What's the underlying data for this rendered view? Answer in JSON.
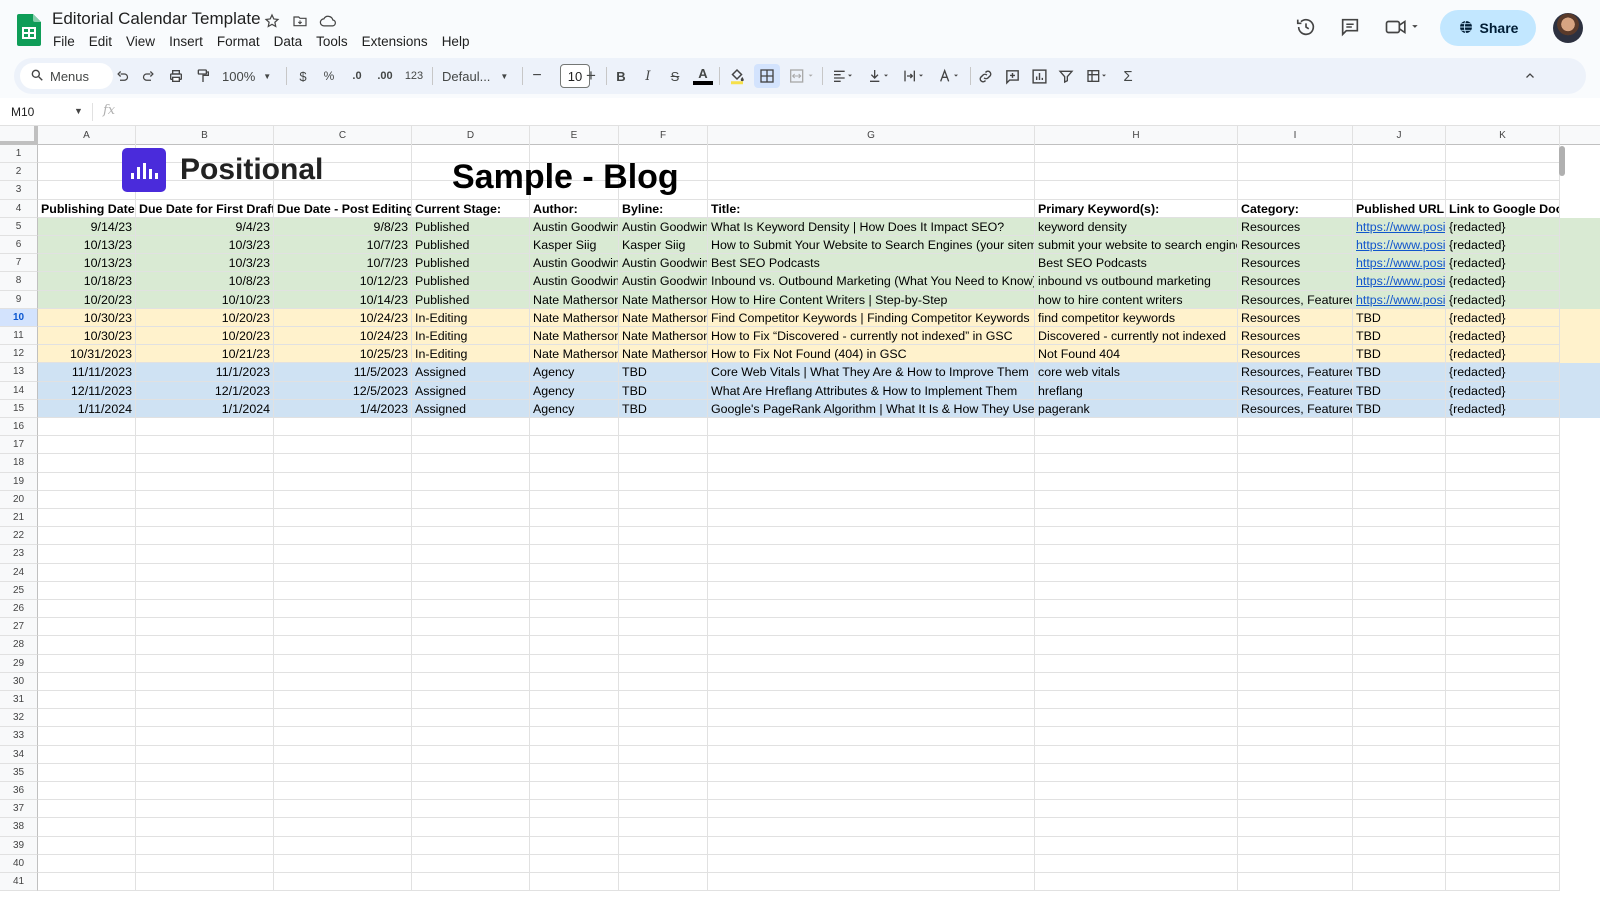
{
  "app": {
    "doc_title": "Editorial Calendar Template",
    "menus": [
      "File",
      "Edit",
      "View",
      "Insert",
      "Format",
      "Data",
      "Tools",
      "Extensions",
      "Help"
    ],
    "share_label": "Share"
  },
  "toolbar": {
    "menus_search": "Menus",
    "zoom": "100%",
    "currency": "$",
    "percent": "%",
    "dec_decrease": ".0",
    "dec_increase": ".00",
    "number_format": "123",
    "font": "Defaul...",
    "font_size": "10",
    "minus": "−",
    "plus": "+",
    "bold": "B",
    "italic": "I",
    "strike": "S",
    "text_color": "A",
    "sigma": "Σ"
  },
  "formula_bar": {
    "name_box": "M10",
    "fx": "fx"
  },
  "columns": [
    "A",
    "B",
    "C",
    "D",
    "E",
    "F",
    "G",
    "H",
    "I",
    "J",
    "K"
  ],
  "brand": {
    "name": "Positional"
  },
  "sheet_title": "Sample - Blog",
  "headers": [
    "Publishing Date:",
    "Due Date for First Draft:",
    "Due Date - Post Editing:",
    "Current Stage:",
    "Author:",
    "Byline:",
    "Title:",
    "Primary Keyword(s):",
    "Category:",
    "Published URL:",
    "Link to Google Doc"
  ],
  "rows": [
    {
      "status": "published",
      "cells": [
        "9/14/23",
        "9/4/23",
        "9/8/23",
        "Published",
        "Austin Goodwin",
        "Austin Goodwin",
        "What Is Keyword Density | How Does It Impact SEO?",
        "keyword density",
        "Resources",
        "https://www.positi",
        "{redacted}"
      ]
    },
    {
      "status": "published",
      "cells": [
        "10/13/23",
        "10/3/23",
        "10/7/23",
        "Published",
        "Kasper Siig",
        "Kasper Siig",
        "How to Submit Your Website to Search Engines (your sitemap)",
        "submit your website to search engines",
        "Resources",
        "https://www.positi",
        "{redacted}"
      ]
    },
    {
      "status": "published",
      "cells": [
        "10/13/23",
        "10/3/23",
        "10/7/23",
        "Published",
        "Austin Goodwin",
        "Austin Goodwin",
        "Best SEO Podcasts",
        "Best SEO Podcasts",
        "Resources",
        "https://www.positi",
        "{redacted}"
      ]
    },
    {
      "status": "published",
      "cells": [
        "10/18/23",
        "10/8/23",
        "10/12/23",
        "Published",
        "Austin Goodwin",
        "Austin Goodwin",
        "Inbound vs. Outbound Marketing (What You Need to Know)",
        "inbound vs outbound marketing",
        "Resources",
        "https://www.positi",
        "{redacted}"
      ]
    },
    {
      "status": "published",
      "cells": [
        "10/20/23",
        "10/10/23",
        "10/14/23",
        "Published",
        "Nate Matherson",
        "Nate Matherson",
        "How to Hire Content Writers | Step-by-Step",
        "how to hire content writers",
        "Resources, Featured",
        "https://www.positi",
        "{redacted}"
      ]
    },
    {
      "status": "editing",
      "cells": [
        "10/30/23",
        "10/20/23",
        "10/24/23",
        "In-Editing",
        "Nate Matherson",
        "Nate Matherson",
        "Find Competitor Keywords | Finding Competitor Keywords",
        "find competitor keywords",
        "Resources",
        "TBD",
        "{redacted}"
      ]
    },
    {
      "status": "editing",
      "cells": [
        "10/30/23",
        "10/20/23",
        "10/24/23",
        "In-Editing",
        "Nate Matherson",
        "Nate Matherson",
        "How to Fix “Discovered - currently not indexed” in GSC",
        "Discovered - currently not indexed",
        "Resources",
        "TBD",
        "{redacted}"
      ]
    },
    {
      "status": "editing",
      "cells": [
        "10/31/2023",
        "10/21/23",
        "10/25/23",
        "In-Editing",
        "Nate Matherson",
        "Nate Matherson",
        "How to Fix Not Found (404) in GSC",
        "Not Found 404",
        "Resources",
        "TBD",
        "{redacted}"
      ]
    },
    {
      "status": "assigned",
      "cells": [
        "11/11/2023",
        "11/1/2023",
        "11/5/2023",
        "Assigned",
        "Agency",
        "TBD",
        "Core Web Vitals | What They Are & How to Improve Them",
        "core web vitals",
        "Resources, Featured",
        "TBD",
        "{redacted}"
      ]
    },
    {
      "status": "assigned",
      "cells": [
        "12/11/2023",
        "12/1/2023",
        "12/5/2023",
        "Assigned",
        "Agency",
        "TBD",
        "What Are Hreflang Attributes & How to Implement Them",
        "hreflang",
        "Resources, Featured",
        "TBD",
        "{redacted}"
      ]
    },
    {
      "status": "assigned",
      "cells": [
        "1/11/2024",
        "1/1/2024",
        "1/4/2023",
        "Assigned",
        "Agency",
        "TBD",
        "Google's PageRank Algorithm | What It Is & How They Use It",
        "pagerank",
        "Resources, Featured",
        "TBD",
        "{redacted}"
      ]
    }
  ],
  "row_numbers": [
    "1",
    "2",
    "3",
    "4",
    "5",
    "6",
    "7",
    "8",
    "9",
    "10",
    "11",
    "12",
    "13",
    "14",
    "15",
    "16",
    "17",
    "18",
    "19",
    "20",
    "21",
    "22",
    "23",
    "24",
    "25",
    "26",
    "27",
    "28",
    "29",
    "30",
    "31",
    "32",
    "33",
    "34",
    "35",
    "36",
    "37",
    "38",
    "39",
    "40",
    "41"
  ],
  "active_row": "10",
  "colors": {
    "published": "#d9ead3",
    "editing": "#fff2cc",
    "assigned": "#cfe2f3",
    "brand": "#4a2bdb",
    "share": "#c2e7ff"
  }
}
